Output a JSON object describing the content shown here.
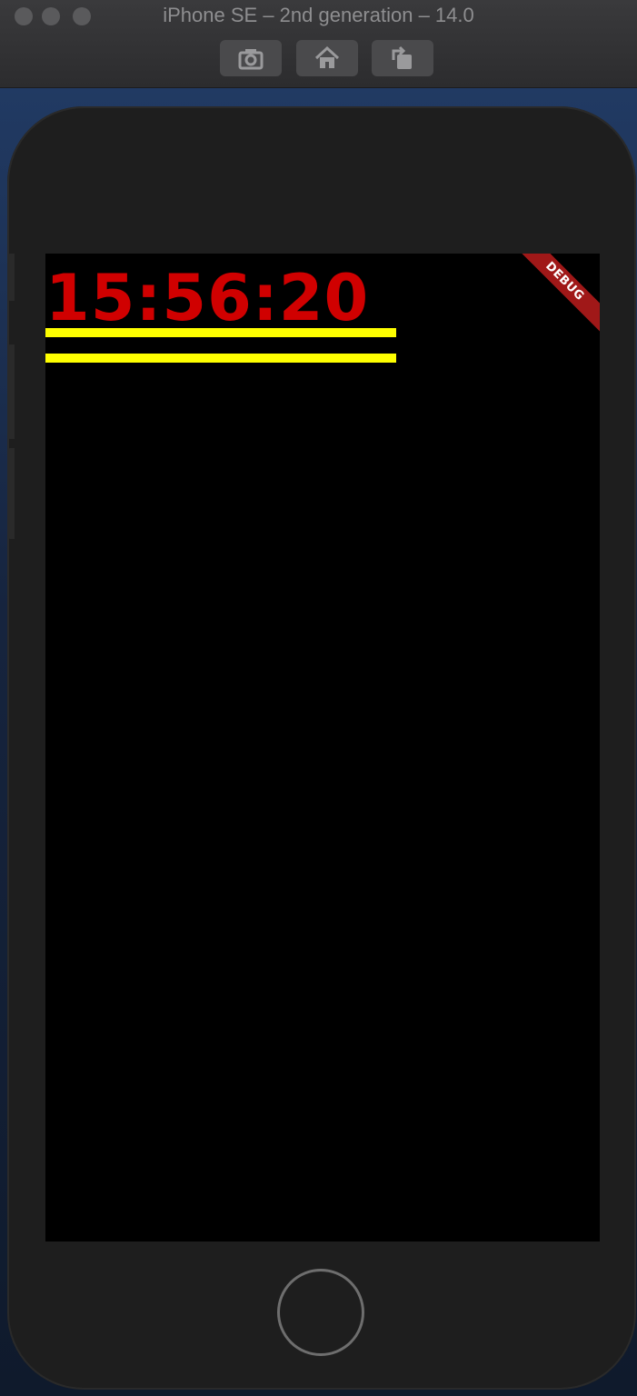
{
  "window": {
    "title": "iPhone SE – 2nd generation – 14.0"
  },
  "toolbar": {
    "buttons": [
      {
        "name": "screenshot",
        "icon": "camera-icon"
      },
      {
        "name": "home",
        "icon": "home-icon"
      },
      {
        "name": "rotate",
        "icon": "rotate-icon"
      }
    ]
  },
  "app": {
    "clock_text": "15:56:20",
    "debug_label": "DEBUG",
    "colors": {
      "clock": "#d00000",
      "bars": "#ffff00",
      "background": "#000000",
      "debug_banner": "#a01818"
    }
  }
}
